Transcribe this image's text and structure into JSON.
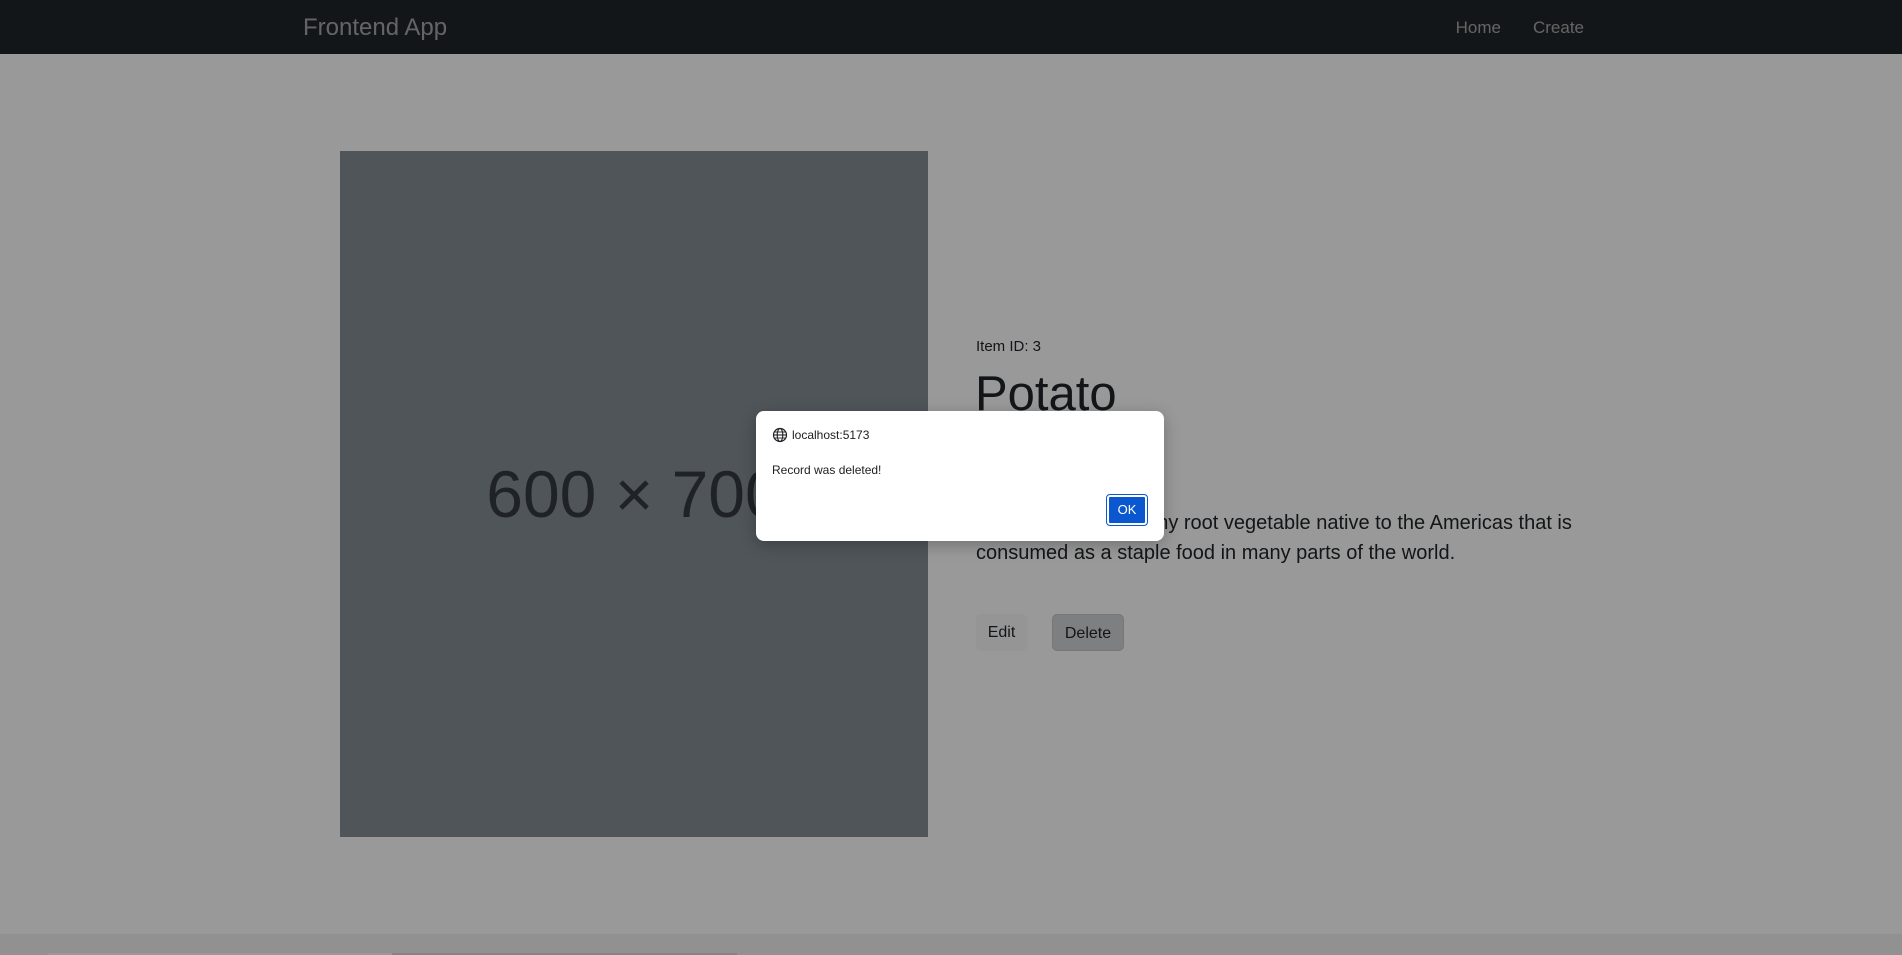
{
  "navbar": {
    "brand": "Frontend App",
    "links": [
      "Home",
      "Create"
    ]
  },
  "item": {
    "image_placeholder": "600 × 700",
    "id_label": "Item ID: 3",
    "title": "Potato",
    "description": "The potato is a starchy root vegetable native to the Americas that is consumed as a staple food in many parts of the world.",
    "edit_label": "Edit",
    "delete_label": "Delete"
  },
  "dialog": {
    "icon": "globe-icon",
    "origin": "localhost:5173",
    "message": "Record was deleted!",
    "ok_label": "OK"
  },
  "colors": {
    "navbar_bg": "#212529",
    "ok_button": "#0b57d0",
    "overlay": "rgba(0,0,0,0.4)"
  }
}
